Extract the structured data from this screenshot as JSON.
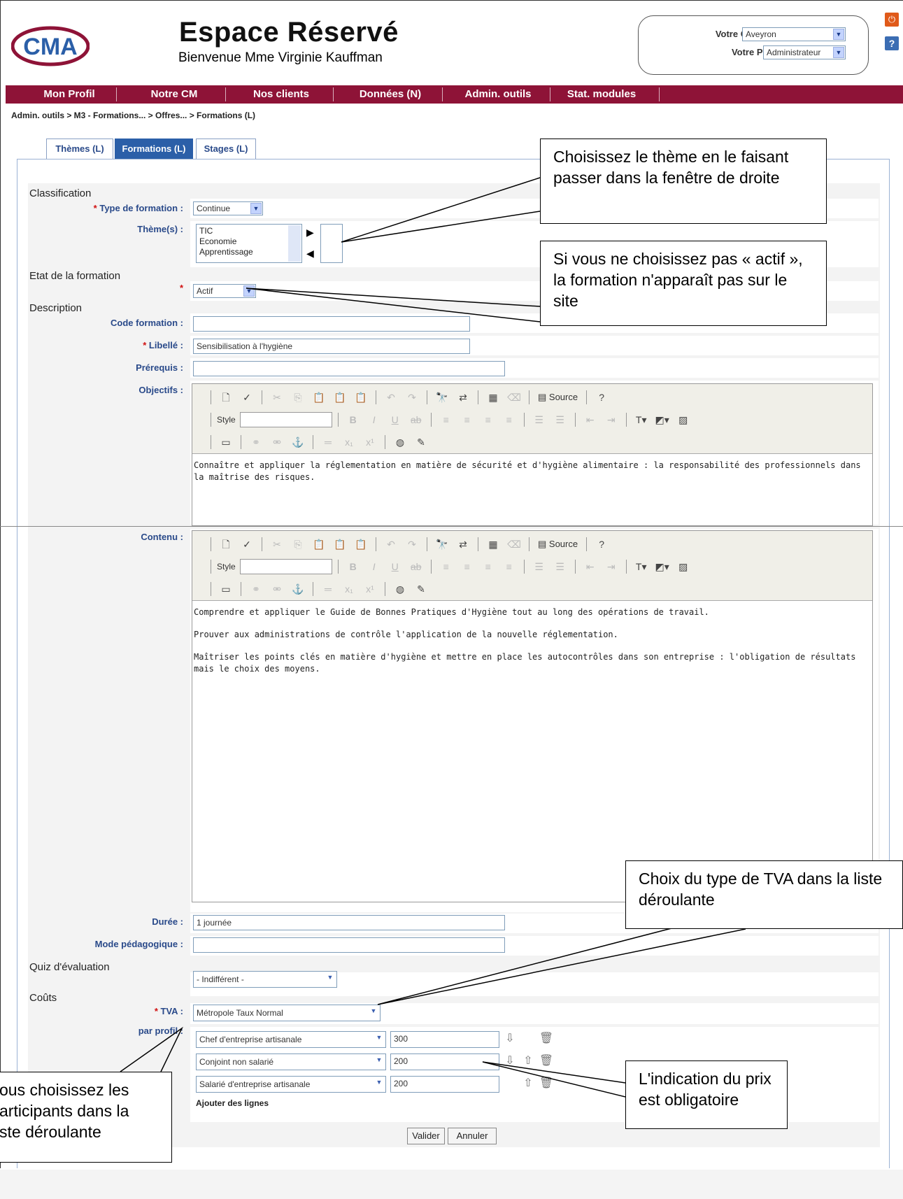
{
  "header": {
    "title": "Espace Réservé",
    "welcome": "Bienvenue  Mme Virginie Kauffman",
    "chambre_label": "Votre Chambre :",
    "chambre_value": "Aveyron",
    "profil_label": "Votre Profil :",
    "profil_value": "Administrateur",
    "logo_text": "CMA"
  },
  "nav": {
    "items": [
      "Mon Profil",
      "Notre CM",
      "Nos clients",
      "Données (N)",
      "Admin. outils",
      "Stat. modules"
    ]
  },
  "breadcrumb": "Admin. outils > M3 - Formations... > Offres... > Formations (L)",
  "tabs": [
    "Thèmes (L)",
    "Formations (L)",
    "Stages (L)"
  ],
  "form": {
    "classification": "Classification",
    "type_label": "Type de formation :",
    "type_value": "Continue",
    "themes_label": "Thème(s) :",
    "themes_options": [
      "TIC",
      "Economie",
      "Apprentissage"
    ],
    "etat_section": "Etat de la formation",
    "etat_value": "Actif",
    "description": "Description",
    "code_label": "Code formation :",
    "code_value": "",
    "libelle_label": "Libellé :",
    "libelle_value": "Sensibilisation à l'hygiène",
    "prerequis_label": "Prérequis :",
    "prerequis_value": "",
    "objectifs_label": "Objectifs :",
    "objectifs_text": "Connaître et appliquer la réglementation en matière de sécurité et d'hygiène alimentaire : la responsabilité des professionnels dans la maîtrise des risques.",
    "contenu_label": "Contenu :",
    "contenu_p1": "Comprendre et appliquer le Guide de Bonnes Pratiques d'Hygiène tout au long des opérations de travail.",
    "contenu_p2": "Prouver aux administrations de contrôle l'application de la nouvelle réglementation.",
    "contenu_p3": "Maîtriser les points clés en matière d'hygiène et mettre en place les autocontrôles dans son entreprise : l'obligation de résultats mais le choix des moyens.",
    "duree_label": "Durée :",
    "duree_value": "1 journée",
    "mode_label": "Mode pédagogique :",
    "mode_value": "",
    "quiz_section": "Quiz d'évaluation",
    "quiz_value": "- Indifférent -",
    "couts_section": "Coûts",
    "tva_label": "TVA :",
    "tva_value": "Métropole Taux Normal",
    "par_profil_label": "par profil :",
    "profils": [
      {
        "name": "Chef d'entreprise artisanale",
        "price": "300"
      },
      {
        "name": "Conjoint non salarié",
        "price": "200"
      },
      {
        "name": "Salarié d'entreprise artisanale",
        "price": "200"
      }
    ],
    "add_lines": "Ajouter des lignes",
    "validate": "Valider",
    "cancel": "Annuler"
  },
  "editor": {
    "style_label": "Style",
    "source_label": "Source"
  },
  "callouts": {
    "theme": "Choisissez le thème en le faisant passer dans la fenêtre de droite",
    "actif": "Si vous ne choisissez pas « actif », la formation n'apparaît pas sur le site",
    "tva": "Choix du type de TVA dans la liste déroulante",
    "prix": "L'indication du prix est obligatoire",
    "participants": "ous choisissez les\narticipants dans la\nste déroulante"
  }
}
